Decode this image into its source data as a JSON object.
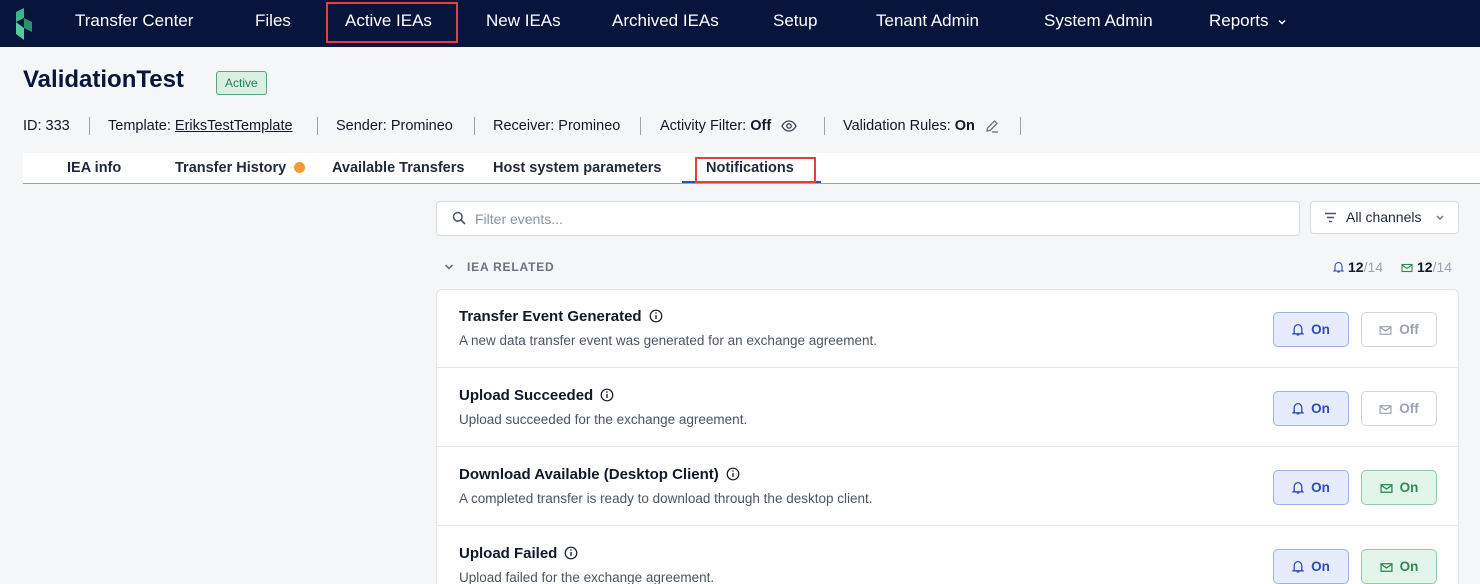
{
  "nav": {
    "items": [
      "Transfer Center",
      "Files",
      "Active IEAs",
      "New IEAs",
      "Archived IEAs",
      "Setup",
      "Tenant Admin",
      "System Admin",
      "Reports"
    ],
    "active": "Active IEAs"
  },
  "header": {
    "title": "ValidationTest",
    "status": "Active"
  },
  "meta": {
    "id": "ID: 333",
    "template_label": "Template:",
    "template_value": "EriksTestTemplate",
    "sender": "Sender: Promineo",
    "receiver": "Receiver: Promineo",
    "activity_label": "Activity Filter:",
    "activity_value": "Off",
    "validation_label": "Validation Rules:",
    "validation_value": "On"
  },
  "tabs": {
    "items": [
      "IEA info",
      "Transfer History",
      "Available Transfers",
      "Host system parameters",
      "Notifications"
    ],
    "active": "Notifications"
  },
  "filter": {
    "placeholder": "Filter events...",
    "channels_label": "All channels"
  },
  "section": {
    "title": "IEA RELATED",
    "bell_count": "12",
    "bell_total": "/14",
    "mail_count": "12",
    "mail_total": "/14"
  },
  "events": [
    {
      "title": "Transfer Event Generated",
      "description": "A new data transfer event was generated for an exchange agreement.",
      "bell": "On",
      "mail": "Off"
    },
    {
      "title": "Upload Succeeded",
      "description": "Upload succeeded for the exchange agreement.",
      "bell": "On",
      "mail": "Off"
    },
    {
      "title": "Download Available (Desktop Client)",
      "description": "A completed transfer is ready to download through the desktop client.",
      "bell": "On",
      "mail": "On"
    },
    {
      "title": "Upload Failed",
      "description": "Upload failed for the exchange agreement.",
      "bell": "On",
      "mail": "On"
    }
  ],
  "colors": {
    "nav_bg": "#07153d",
    "accent": "#2d4eb5",
    "highlight": "#e0403e",
    "on_green": "#2e8a55",
    "status_green": "#2b7a52",
    "dot_orange": "#f59a2c"
  }
}
